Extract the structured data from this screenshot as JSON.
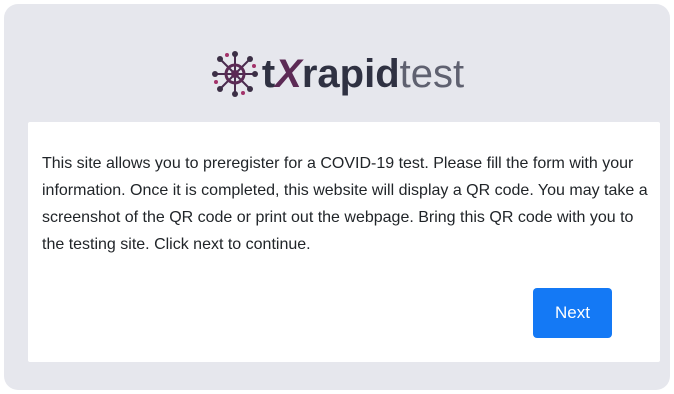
{
  "brand": {
    "logo_t": "t",
    "logo_x": "X",
    "logo_rapid": "rapid",
    "logo_test": "test",
    "logo_icon": "virus-network-icon",
    "colors": {
      "dark": "#2f3142",
      "accent": "#5c2a55",
      "light": "#5f6170"
    }
  },
  "intro": {
    "message": "This site allows you to preregister for a COVID-19 test. Please fill the form with your information. Once it is completed, this website will display a QR code. You may take a screenshot of the QR code or print out the webpage. Bring this QR code with you to the testing site. Click next to continue.",
    "next_label": "Next"
  },
  "colors": {
    "card_background": "#e6e7ed",
    "button_primary": "#1479f5"
  }
}
